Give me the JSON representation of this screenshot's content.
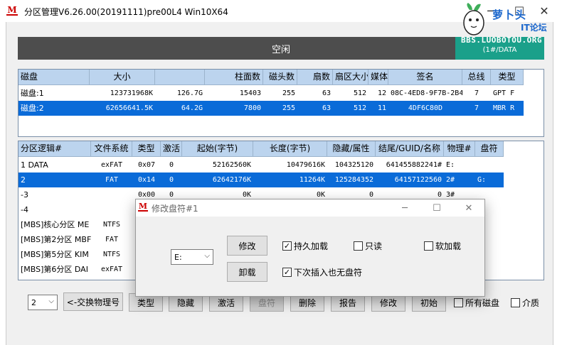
{
  "window": {
    "title": "分区管理V6.26.00(20191111)pre00L4 Win10X64",
    "close_glyph": "✕",
    "maximize_glyph": "☐",
    "minimize_glyph": "─"
  },
  "watermark": {
    "name": "萝卜头",
    "sub": "IT论坛",
    "url": "BBS.LUOBOTOU.ORG"
  },
  "status": {
    "text": "空闲",
    "extra_text": "(1#/DATA"
  },
  "disk_table": {
    "headers": [
      "磁盘",
      "大小",
      "",
      "柱面数",
      "磁头数",
      "扇数",
      "扇区大小",
      "媒体",
      "签名",
      "总线",
      "类型"
    ],
    "rows": [
      [
        "磁盘:1",
        "123731968K",
        "126.7G",
        "15403",
        "255",
        "63",
        "512",
        "12",
        "08C-4ED8-9F7B-2B4",
        "7",
        "GPT F"
      ],
      [
        "磁盘:2",
        "62656641.5K",
        "64.2G",
        "7800",
        "255",
        "63",
        "512",
        "11",
        "4DF6C80D",
        "7",
        "MBR R"
      ]
    ],
    "selected_row": 1
  },
  "partition_table": {
    "headers": [
      "分区逻辑#",
      "文件系统",
      "类型",
      "激活",
      "起始(字节)",
      "长度(字节)",
      "隐藏/属性",
      "结尾/GUID/名称",
      "物理#",
      "盘符"
    ],
    "rows": [
      [
        "1 DATA",
        "exFAT",
        "0x07",
        "0",
        "52162560K",
        "10479616K",
        "104325120",
        "641455882241#",
        "E:"
      ],
      [
        "2",
        "FAT",
        "0x14",
        "0",
        "62642176K",
        "11264K",
        "125284352",
        "64157122560",
        "2#",
        "G:"
      ],
      [
        "-3",
        "",
        "0x00",
        "0",
        "0K",
        "0K",
        "0",
        "0",
        "3#",
        ""
      ],
      [
        "-4",
        "",
        "",
        "",
        "",
        "",
        "",
        "",
        "",
        ""
      ],
      [
        "[MBS]核心分区 ME",
        "NTFS",
        "",
        "",
        "",
        "",
        "",
        "",
        "",
        ""
      ],
      [
        "[MBS]第2分区 MBF",
        "FAT",
        "",
        "",
        "",
        "",
        "",
        "",
        "",
        ""
      ],
      [
        "[MBS]第5分区 KIM",
        "NTFS",
        "",
        "",
        "",
        "",
        "",
        "",
        "",
        ""
      ],
      [
        "[MBS]第6分区 DAI",
        "exFAT",
        "",
        "",
        "",
        "",
        "",
        "",
        "",
        ""
      ]
    ],
    "selected_row": 1
  },
  "toolbar": {
    "disk_select_value": "2",
    "swap_label": "<-交换物理号",
    "type_label": "类型",
    "hide_label": "隐藏",
    "activate_label": "激活",
    "letter_label": "盘符",
    "delete_label": "删除",
    "report_label": "报告",
    "modify_label": "修改",
    "init_label": "初始",
    "all_disks_label": "所有磁盘",
    "media_label": "介质"
  },
  "dialog": {
    "title": "修改盘符#1",
    "drive_select_value": "E:",
    "modify_button": "修改",
    "unload_button": "卸载",
    "persistent_label": "持久加载",
    "readonly_label": "只读",
    "soft_load_label": "软加载",
    "no_letter_next_label": "下次插入也无盘符",
    "persistent_checked": true,
    "readonly_checked": false,
    "soft_load_checked": false,
    "no_letter_next_checked": true,
    "check_glyph": "✓"
  }
}
